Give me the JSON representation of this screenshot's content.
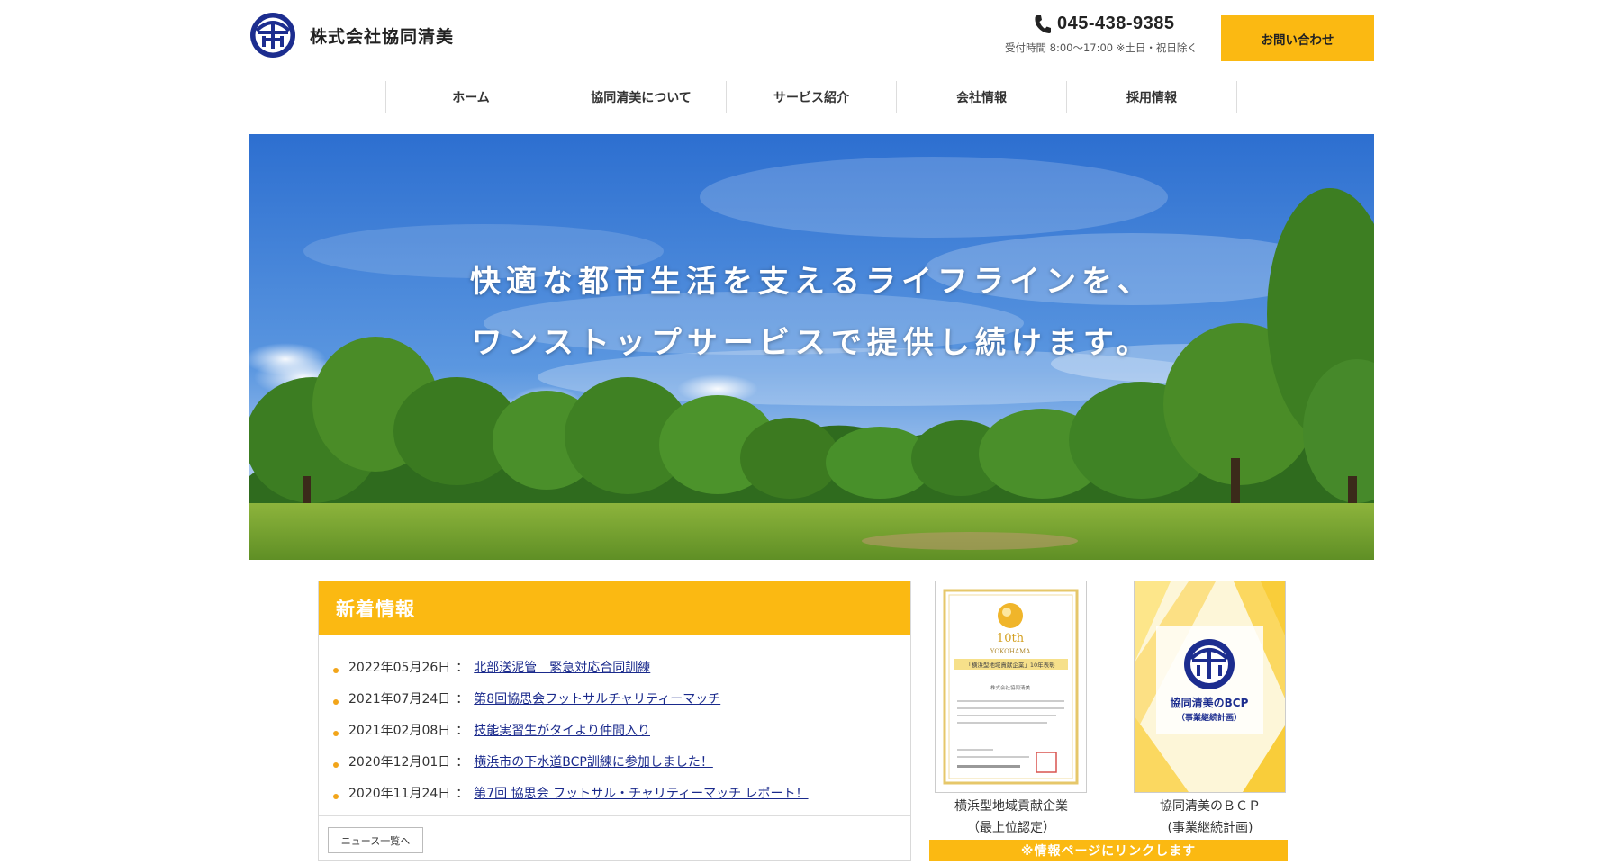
{
  "company": {
    "name": "株式会社協同清美",
    "logo_icon": "kyodo-seibi-logo-icon"
  },
  "header": {
    "phone_icon": "phone-icon",
    "phone": "045-438-9385",
    "hours": "受付時間 8:00〜17:00 ※土日・祝日除く",
    "contact_label": "お問い合わせ"
  },
  "nav": {
    "items": [
      {
        "label": "ホーム"
      },
      {
        "label": "協同清美について"
      },
      {
        "label": "サービス紹介"
      },
      {
        "label": "会社情報"
      },
      {
        "label": "採用情報"
      }
    ]
  },
  "hero": {
    "line1": "快適な都市生活を支えるライフラインを、",
    "line2": "ワンストップサービスで提供し続けます。",
    "image": "park-landscape-photo"
  },
  "news": {
    "title": "新着情報",
    "separator": "：",
    "items": [
      {
        "date": "2022年05月26日",
        "title": "北部送泥管　緊急対応合同訓練"
      },
      {
        "date": "2021年07月24日",
        "title": "第8回協思会フットサルチャリティーマッチ"
      },
      {
        "date": "2021年02月08日",
        "title": "技能実習生がタイより仲間入り"
      },
      {
        "date": "2020年12月01日",
        "title": "横浜市の下水道BCP訓練に参加しました！"
      },
      {
        "date": "2020年11月24日",
        "title": "第7回 協思会 フットサル・チャリティーマッチ レポート！"
      }
    ],
    "more_label": "ニュース一覧へ"
  },
  "cards": [
    {
      "image": "yokohama-certificate-image",
      "caption_line1": "横浜型地域貢献企業",
      "caption_line2": "（最上位認定）",
      "cert": {
        "badge": "10th",
        "city": "YOKOHAMA",
        "banner": "「横浜型地域貢献企業」10年表彰",
        "company": "株式会社協同清美"
      }
    },
    {
      "image": "bcp-document-image",
      "caption_line1": "協同清美のＢＣＰ",
      "caption_line2": "(事業継続計画)",
      "cover": {
        "title": "協同清美のBCP",
        "subtitle": "（事業継続計画）"
      }
    }
  ],
  "link_note": "※情報ページにリンクします",
  "colors": {
    "accent": "#fbb912",
    "link": "#1a2a8c",
    "logo": "#1c2d8f"
  }
}
